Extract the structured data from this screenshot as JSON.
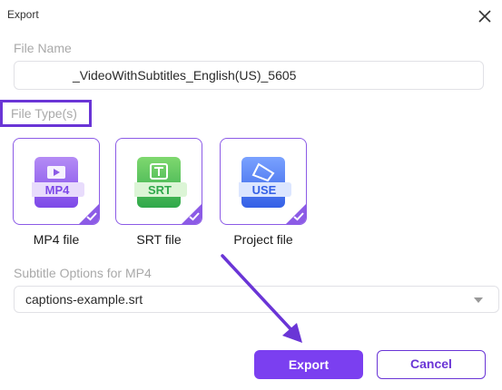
{
  "dialog": {
    "title": "Export",
    "close_icon": "close-icon"
  },
  "file_name": {
    "label": "File Name",
    "value": "_VideoWithSubtitles_English(US)_5605"
  },
  "file_types": {
    "label": "File Type(s)",
    "options": [
      {
        "label": "MP4 file",
        "badge": "MP4",
        "icon": "mp4-file-icon",
        "color": "#8c5be6",
        "selected": true
      },
      {
        "label": "SRT file",
        "badge": "SRT",
        "icon": "srt-file-icon",
        "color": "#3bb54a",
        "selected": true
      },
      {
        "label": "Project file",
        "badge": "USE",
        "icon": "project-file-icon",
        "color": "#3f6ff0",
        "selected": true
      }
    ]
  },
  "subtitle_options": {
    "label": "Subtitle Options for MP4",
    "selected": "captions-example.srt"
  },
  "buttons": {
    "export": "Export",
    "cancel": "Cancel"
  },
  "colors": {
    "accent": "#7b3ff0",
    "highlight": "#6a35d6"
  }
}
